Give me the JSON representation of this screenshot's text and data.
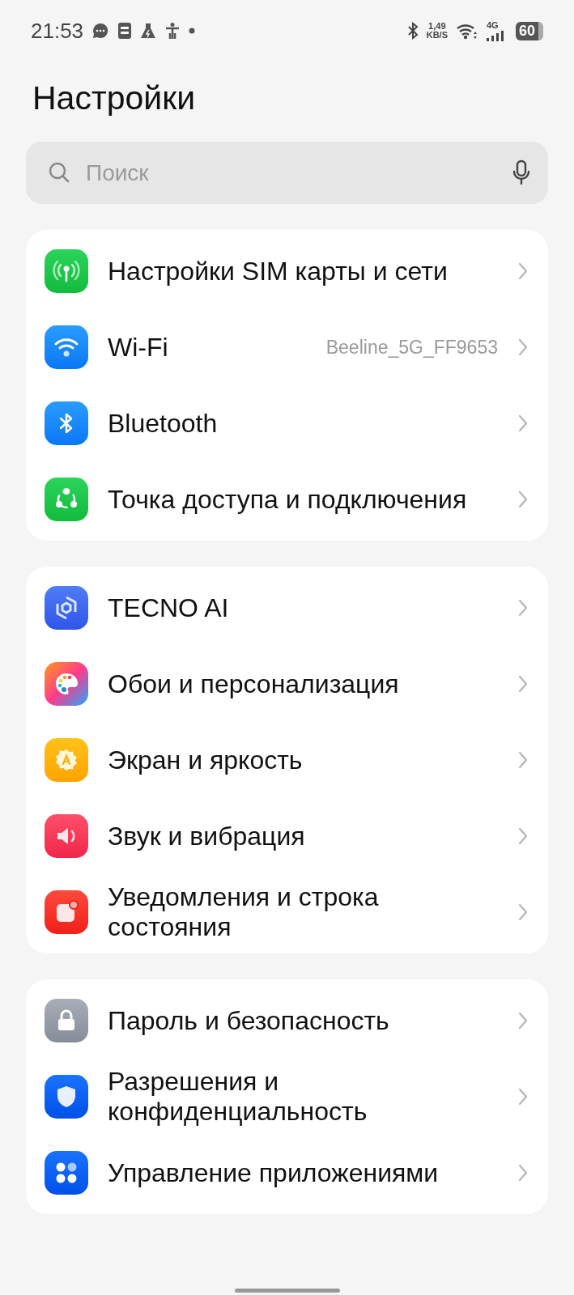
{
  "status_bar": {
    "time": "21:53",
    "speed": "1,49",
    "speed_unit": "KB/S",
    "network": "4G",
    "battery": "60"
  },
  "title": "Настройки",
  "search": {
    "placeholder": "Поиск"
  },
  "groups": [
    {
      "items": [
        {
          "kind": "antenna",
          "label": "Настройки SIM карты и сети"
        },
        {
          "kind": "wifi",
          "label": "Wi-Fi",
          "value": "Beeline_5G_FF9653"
        },
        {
          "kind": "bluetooth",
          "label": "Bluetooth"
        },
        {
          "kind": "hotspot",
          "label": "Точка доступа и подключения"
        }
      ]
    },
    {
      "items": [
        {
          "kind": "ai",
          "label": "TECNO AI"
        },
        {
          "kind": "palette",
          "label": "Обои и персонализация"
        },
        {
          "kind": "display",
          "label": "Экран и яркость"
        },
        {
          "kind": "sound",
          "label": "Звук и вибрация"
        },
        {
          "kind": "notify",
          "label": "Уведомления и строка состояния"
        }
      ]
    },
    {
      "items": [
        {
          "kind": "lock",
          "label": "Пароль и безопасность"
        },
        {
          "kind": "shield",
          "label": "Разрешения и конфиденциальность"
        },
        {
          "kind": "apps",
          "label": "Управление приложениями"
        }
      ]
    }
  ]
}
